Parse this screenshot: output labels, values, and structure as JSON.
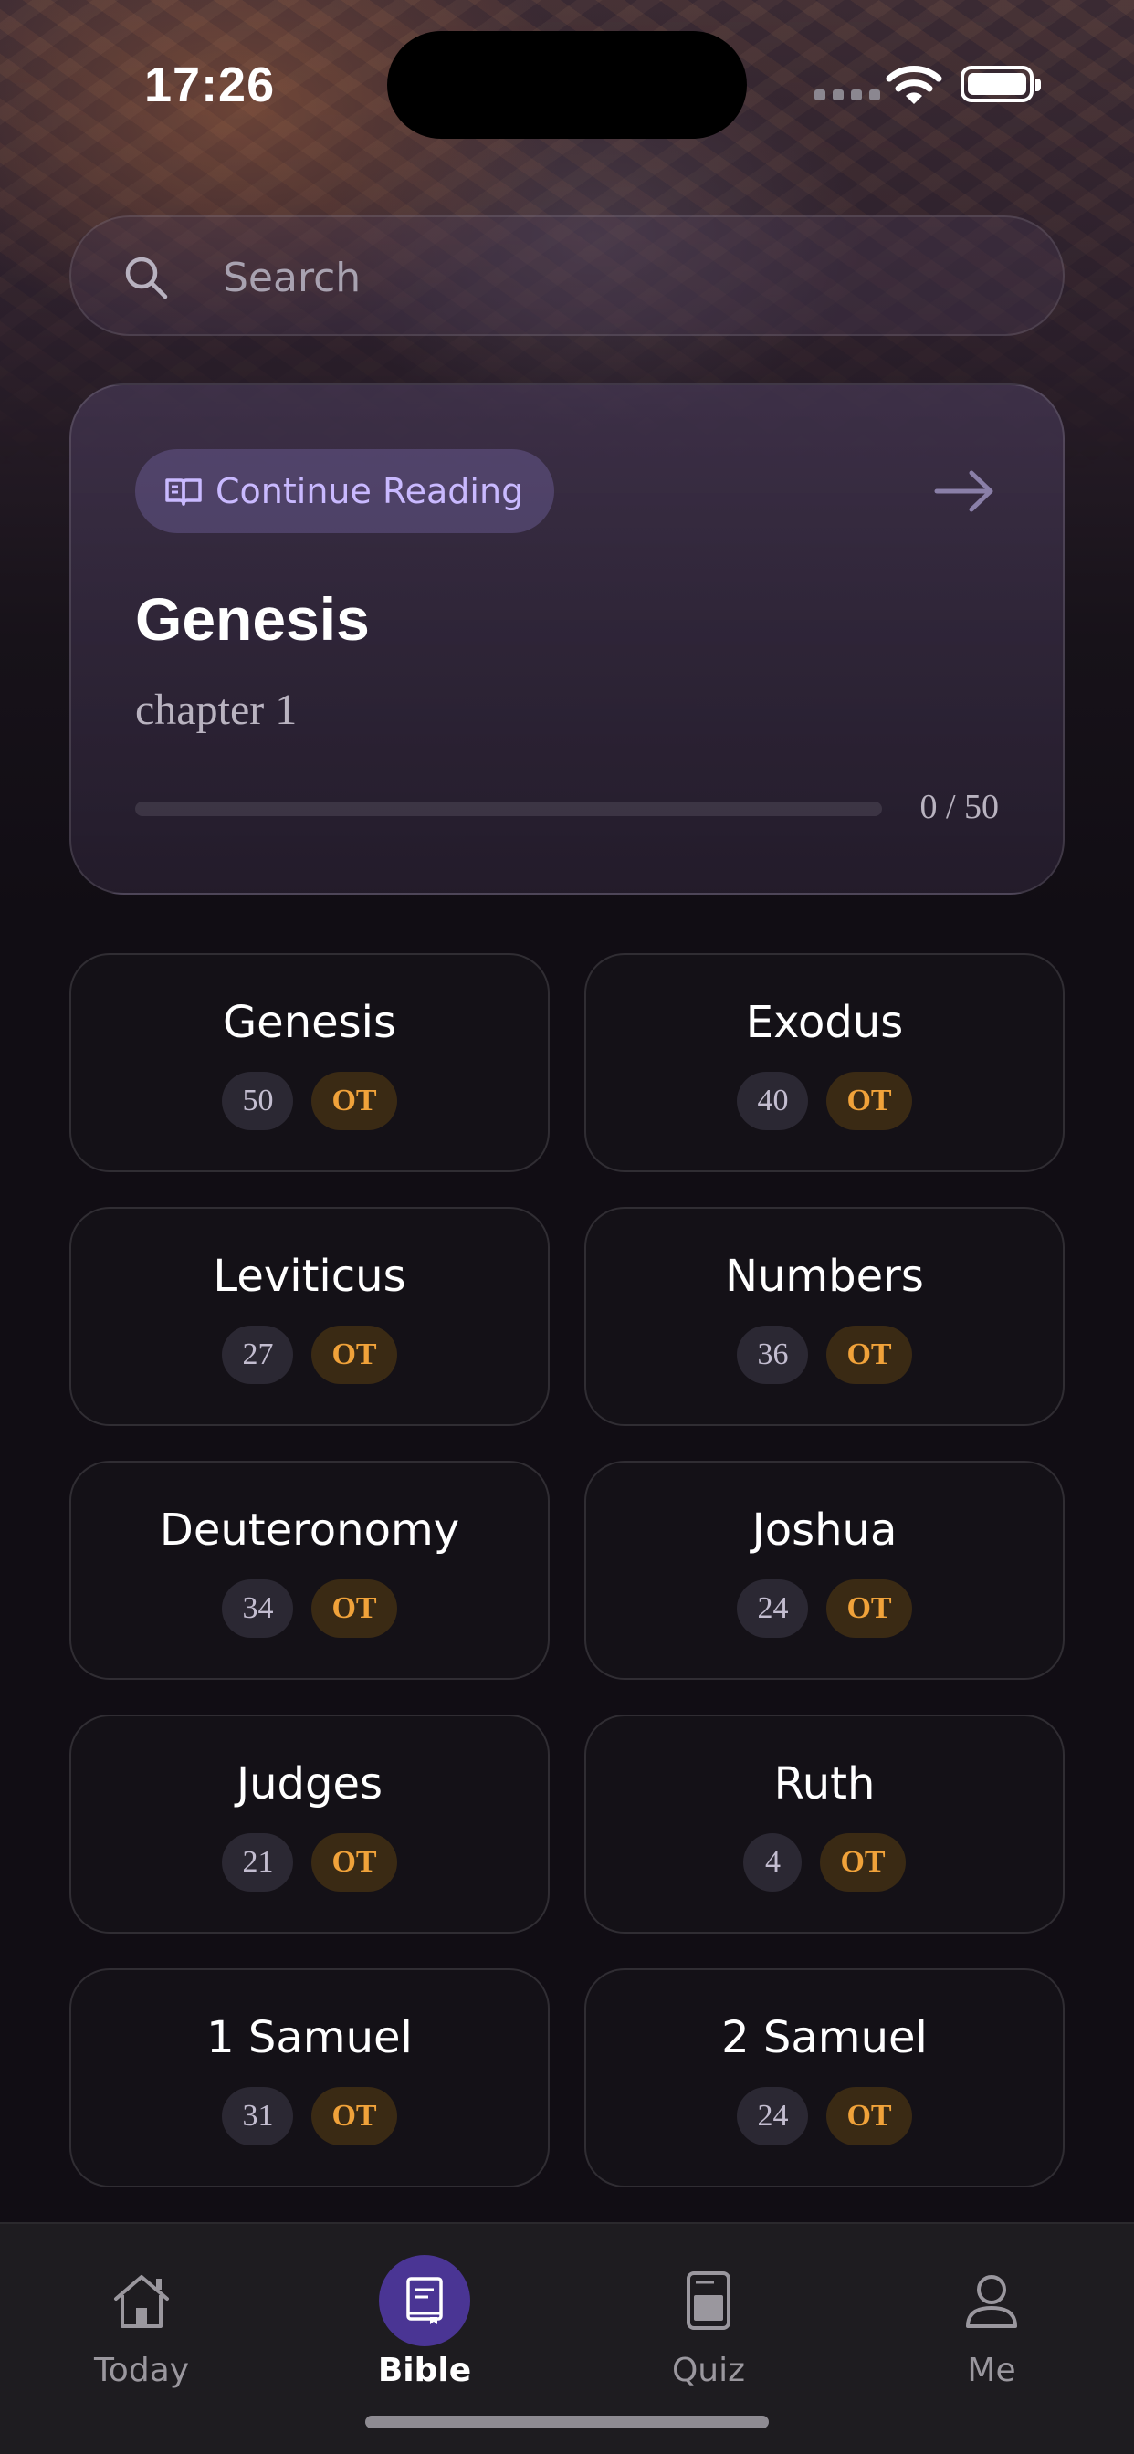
{
  "status_bar": {
    "time": "17:26"
  },
  "search": {
    "placeholder": "Search",
    "icon": "search-icon"
  },
  "continue_reading": {
    "label": "Continue Reading",
    "book": "Genesis",
    "chapter": "chapter 1",
    "progress_text": "0 / 50",
    "progress_fraction": 0,
    "label_icon": "open-book-icon",
    "action_icon": "arrow-right-icon"
  },
  "books": [
    {
      "name": "Genesis",
      "chapters": "50",
      "testament": "OT"
    },
    {
      "name": "Exodus",
      "chapters": "40",
      "testament": "OT"
    },
    {
      "name": "Leviticus",
      "chapters": "27",
      "testament": "OT"
    },
    {
      "name": "Numbers",
      "chapters": "36",
      "testament": "OT"
    },
    {
      "name": "Deuteronomy",
      "chapters": "34",
      "testament": "OT"
    },
    {
      "name": "Joshua",
      "chapters": "24",
      "testament": "OT"
    },
    {
      "name": "Judges",
      "chapters": "21",
      "testament": "OT"
    },
    {
      "name": "Ruth",
      "chapters": "4",
      "testament": "OT"
    },
    {
      "name": "1 Samuel",
      "chapters": "31",
      "testament": "OT"
    },
    {
      "name": "2 Samuel",
      "chapters": "24",
      "testament": "OT"
    }
  ],
  "tabs": [
    {
      "label": "Today",
      "icon": "home-icon",
      "active": false
    },
    {
      "label": "Bible",
      "icon": "bible-icon",
      "active": true
    },
    {
      "label": "Quiz",
      "icon": "quiz-icon",
      "active": false
    },
    {
      "label": "Me",
      "icon": "person-icon",
      "active": false
    }
  ],
  "colors": {
    "accent": "#8a6cff",
    "accent_active_tab": "#4a3594",
    "testament_badge_text": "#f0a23a",
    "continue_label": "#c9b9ff"
  }
}
